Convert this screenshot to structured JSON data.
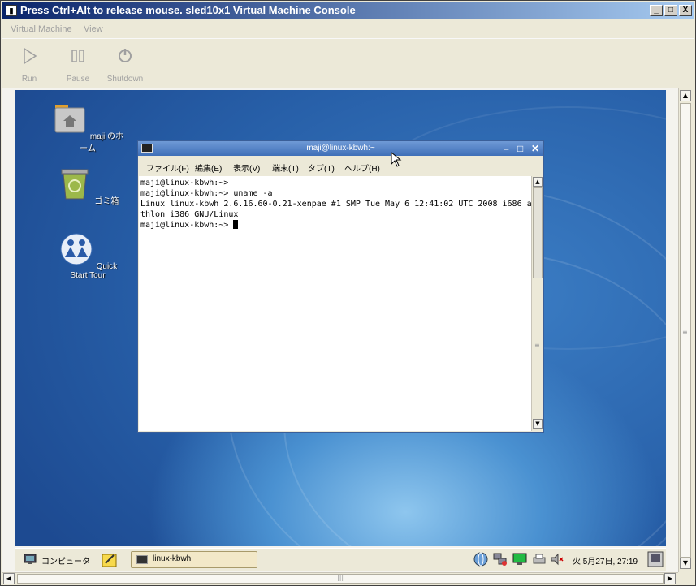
{
  "window": {
    "title": "Press Ctrl+Alt to release mouse. sled10x1 Virtual Machine Console",
    "controls": [
      "_",
      "□",
      "X"
    ]
  },
  "menubar": {
    "items": [
      "Virtual Machine",
      "View"
    ]
  },
  "toolbar": {
    "run": "Run",
    "pause": "Pause",
    "shutdown": "Shutdown"
  },
  "desktop": {
    "icons": {
      "home": "maji のホーム",
      "trash": "ゴミ箱",
      "tour": "Quick Start Tour"
    }
  },
  "terminal": {
    "title": "maji@linux-kbwh:~",
    "menu": [
      "ファイル(F)",
      "編集(E)",
      "表示(V)",
      "端末(T)",
      "タブ(T)",
      "ヘルプ(H)"
    ],
    "lines": [
      "maji@linux-kbwh:~>",
      "maji@linux-kbwh:~> uname -a",
      "Linux linux-kbwh 2.6.16.60-0.21-xenpae #1 SMP Tue May 6 12:41:02 UTC 2008 i686 a",
      "thlon i386 GNU/Linux"
    ],
    "prompt": "maji@linux-kbwh:~> "
  },
  "panel": {
    "computer": "コンピュータ",
    "task": "linux-kbwh",
    "clock": "火  5月27日, 27:19"
  },
  "colors": {
    "title_start": "#0a246a",
    "title_end": "#a6caf0",
    "desktop_blue": "#2a63aa",
    "terminal_title": "#4f7fc4"
  }
}
